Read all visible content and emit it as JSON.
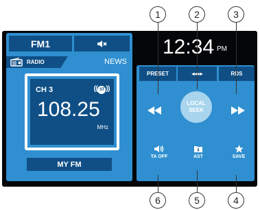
{
  "band_button": {
    "label": "FM1"
  },
  "mute_button": {
    "icon": "speaker-mute-icon"
  },
  "source": {
    "label": "RADIO",
    "category": "NEWS"
  },
  "display": {
    "channel": "CH 3",
    "stereo_badge": "ST",
    "frequency": "108.25",
    "unit": "MHz"
  },
  "station_name": "MY FM",
  "clock": {
    "time": "12:34",
    "ampm": "PM"
  },
  "tabs": {
    "preset": "PRESET",
    "scan": "◂◂▸▸",
    "rds": "RDS"
  },
  "local_seek": {
    "line1": "LOCAL",
    "line2": "SEEK"
  },
  "function_buttons": {
    "ta": "TA OFF",
    "ast": "AST",
    "save": "SAVE"
  },
  "callouts": {
    "c1": "1",
    "c2": "2",
    "c3": "3",
    "c4": "4",
    "c5": "5",
    "c6": "6"
  },
  "colors": {
    "panel": "#2f8fd0",
    "dark": "#0f4f86",
    "screen": "#050608",
    "local_seek": "#a8d4ee"
  }
}
